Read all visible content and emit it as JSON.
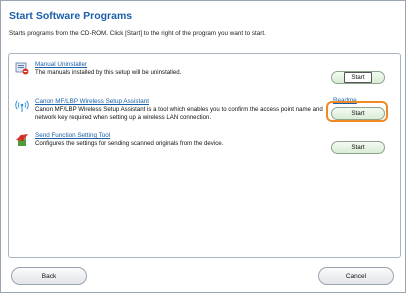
{
  "header": {
    "title": "Start Software Programs",
    "subtitle": "Starts programs from the CD-ROM. Click [Start] to the right of the program you want to start."
  },
  "programs": [
    {
      "name": "Manual Uninstaller",
      "description": "The manuals installed by this setup will be uninstalled.",
      "start_label": "Start",
      "icon": "uninstaller-icon"
    },
    {
      "name": "Canon MF/LBP Wireless Setup Assistant",
      "description": "Canon MF/LBP Wireless Setup Assistant is a tool which enables you to confirm the access point name and network key required when setting up a wireless LAN connection.",
      "readme_label": "Readme",
      "start_label": "Start",
      "icon": "wireless-icon"
    },
    {
      "name": "Send Function Setting Tool",
      "description": "Configures the settings for sending scanned originals from the device.",
      "start_label": "Start",
      "icon": "send-function-icon"
    }
  ],
  "footer": {
    "back_label": "Back",
    "cancel_label": "Cancel"
  },
  "colors": {
    "title": "#1a5fa8",
    "highlight": "#f08a24",
    "start_button": "#d9ecd5"
  }
}
